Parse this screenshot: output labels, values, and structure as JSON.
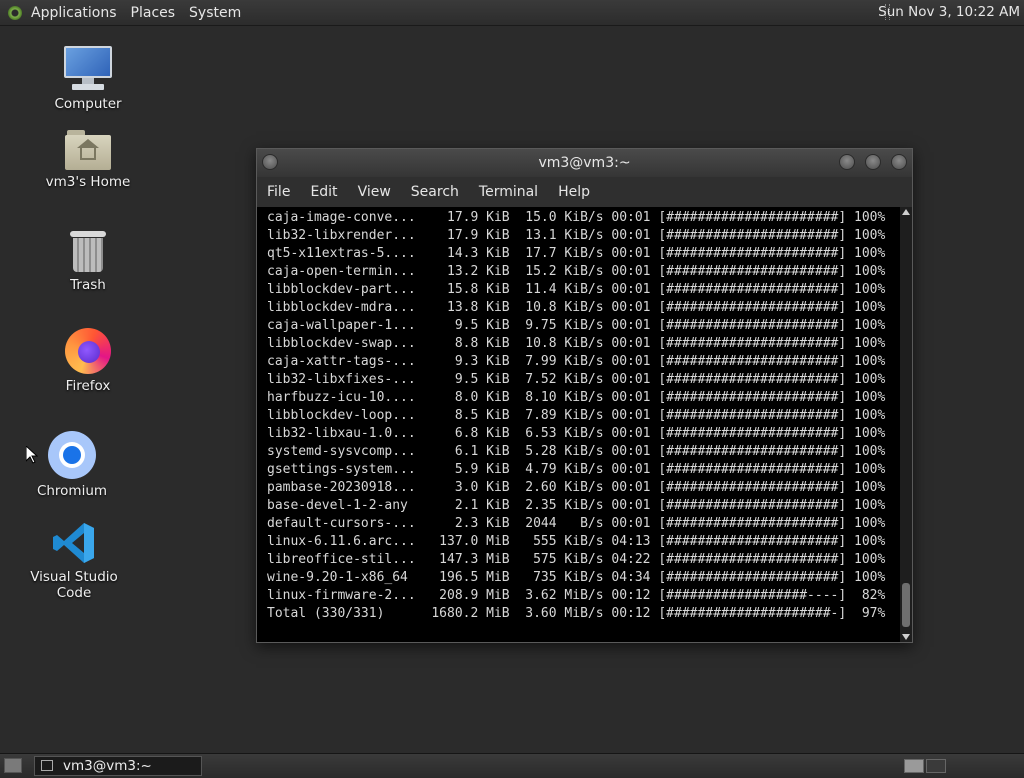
{
  "top_panel": {
    "menus": [
      "Applications",
      "Places",
      "System"
    ],
    "clock": "Sun Nov  3, 10:22 AM"
  },
  "desktop_icons": [
    {
      "label": "Computer",
      "icon": "computer-icon"
    },
    {
      "label": "vm3's Home",
      "icon": "home-folder-icon"
    },
    {
      "label": "Trash",
      "icon": "trash-icon"
    },
    {
      "label": "Firefox",
      "icon": "firefox-icon"
    },
    {
      "label": "Chromium",
      "icon": "chromium-icon"
    },
    {
      "label": "Visual Studio Code",
      "icon": "vscode-icon"
    }
  ],
  "terminal": {
    "title": "vm3@vm3:~",
    "menu": [
      "File",
      "Edit",
      "View",
      "Search",
      "Terminal",
      "Help"
    ],
    "lines": [
      "caja-image-conve...    17.9 KiB  15.0 KiB/s 00:01 [######################] 100%",
      "lib32-libxrender...    17.9 KiB  13.1 KiB/s 00:01 [######################] 100%",
      "qt5-x11extras-5....    14.3 KiB  17.7 KiB/s 00:01 [######################] 100%",
      "caja-open-termin...    13.2 KiB  15.2 KiB/s 00:01 [######################] 100%",
      "libblockdev-part...    15.8 KiB  11.4 KiB/s 00:01 [######################] 100%",
      "libblockdev-mdra...    13.8 KiB  10.8 KiB/s 00:01 [######################] 100%",
      "caja-wallpaper-1...     9.5 KiB  9.75 KiB/s 00:01 [######################] 100%",
      "libblockdev-swap...     8.8 KiB  10.8 KiB/s 00:01 [######################] 100%",
      "caja-xattr-tags-...     9.3 KiB  7.99 KiB/s 00:01 [######################] 100%",
      "lib32-libxfixes-...     9.5 KiB  7.52 KiB/s 00:01 [######################] 100%",
      "harfbuzz-icu-10....     8.0 KiB  8.10 KiB/s 00:01 [######################] 100%",
      "libblockdev-loop...     8.5 KiB  7.89 KiB/s 00:01 [######################] 100%",
      "lib32-libxau-1.0...     6.8 KiB  6.53 KiB/s 00:01 [######################] 100%",
      "systemd-sysvcomp...     6.1 KiB  5.28 KiB/s 00:01 [######################] 100%",
      "gsettings-system...     5.9 KiB  4.79 KiB/s 00:01 [######################] 100%",
      "pambase-20230918...     3.0 KiB  2.60 KiB/s 00:01 [######################] 100%",
      "base-devel-1-2-any      2.1 KiB  2.35 KiB/s 00:01 [######################] 100%",
      "default-cursors-...     2.3 KiB  2044   B/s 00:01 [######################] 100%",
      "linux-6.11.6.arc...   137.0 MiB   555 KiB/s 04:13 [######################] 100%",
      "libreoffice-stil...   147.3 MiB   575 KiB/s 04:22 [######################] 100%",
      "wine-9.20-1-x86_64    196.5 MiB   735 KiB/s 04:34 [######################] 100%",
      "linux-firmware-2...   208.9 MiB  3.62 MiB/s 00:12 [##################----]  82%",
      "Total (330/331)      1680.2 MiB  3.60 MiB/s 00:12 [#####################-]  97%"
    ]
  },
  "bottom_panel": {
    "task": "vm3@vm3:~"
  }
}
